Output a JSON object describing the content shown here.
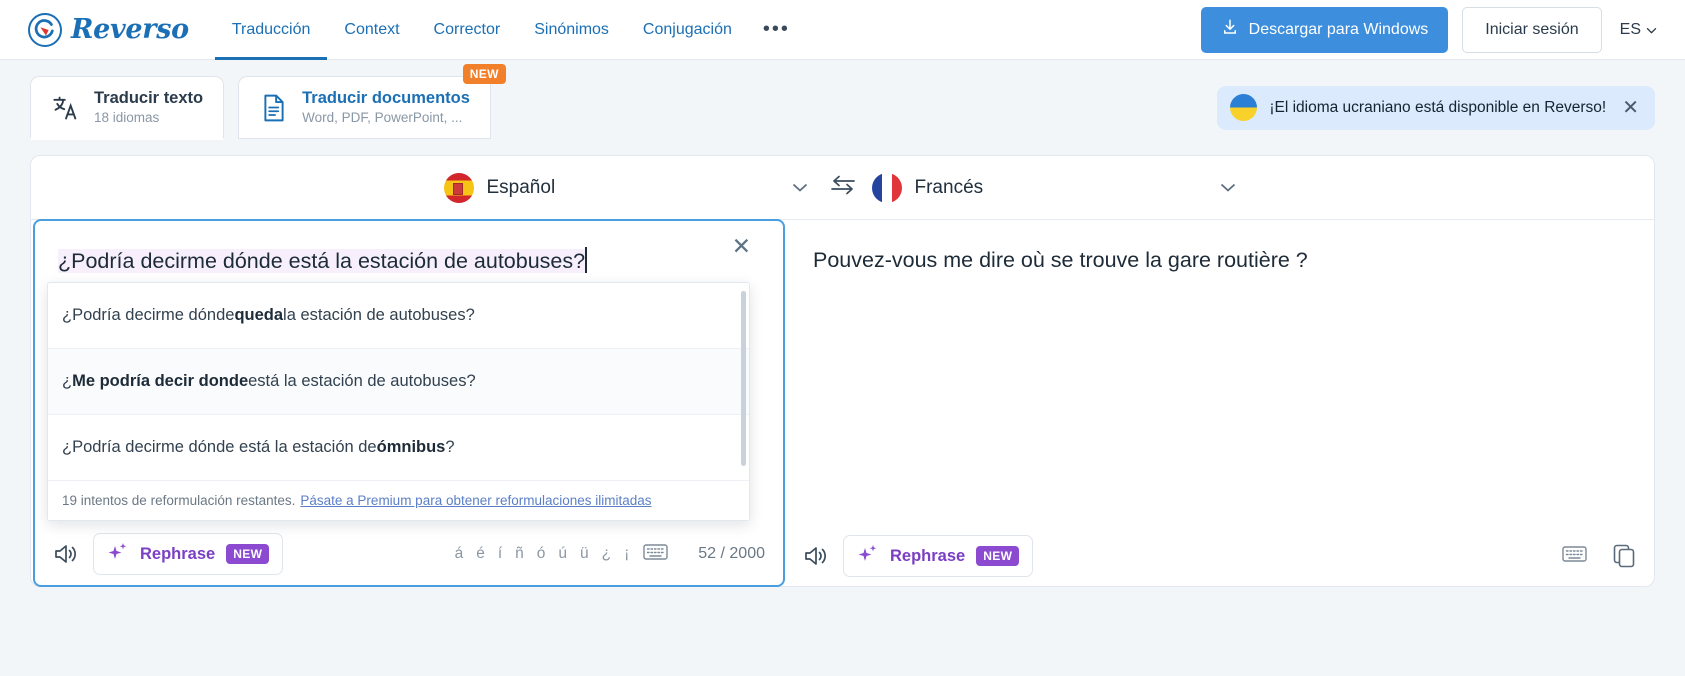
{
  "header": {
    "brand": "Reverso",
    "nav": [
      {
        "label": "Traducción",
        "active": true
      },
      {
        "label": "Context",
        "active": false
      },
      {
        "label": "Corrector",
        "active": false
      },
      {
        "label": "Sinónimos",
        "active": false
      },
      {
        "label": "Conjugación",
        "active": false
      }
    ],
    "more_label": "•••",
    "download_label": "Descargar para Windows",
    "login_label": "Iniciar sesión",
    "ui_language": "ES",
    "accent_color": "#1b6fb5",
    "download_bg": "#3d8fdd"
  },
  "tabs": [
    {
      "title": "Traducir texto",
      "subtitle": "18 idiomas",
      "icon": "translate-icon",
      "badge": null,
      "active": true
    },
    {
      "title": "Traducir documentos",
      "subtitle": "Word, PDF, PowerPoint, ...",
      "icon": "document-icon",
      "badge": "NEW",
      "active": false
    }
  ],
  "banner": {
    "icon": "ukraine-flag-icon",
    "text": "¡El idioma ucraniano está disponible en Reverso!",
    "close_label": "✕",
    "bg": "#dbeafc"
  },
  "language_bar": {
    "source": {
      "name": "Español",
      "flag": "spain-flag-icon"
    },
    "target": {
      "name": "Francés",
      "flag": "france-flag-icon"
    },
    "swap_label": "swap-languages-icon",
    "chevron": "⌄"
  },
  "source_pane": {
    "text": "¿Podría decirme dónde está la estación de autobuses?",
    "clear_label": "✕",
    "toolbar": {
      "speaker": "speaker-icon",
      "rephrase_label": "Rephrase",
      "rephrase_badge": "NEW",
      "accents": [
        "á",
        "é",
        "í",
        "ñ",
        "ó",
        "ú",
        "ü",
        "¿",
        "¡"
      ],
      "keyboard": "keyboard-icon",
      "counter": "52 / 2000"
    }
  },
  "target_pane": {
    "text": "Pouvez-vous me dire où se trouve la gare routière ?",
    "toolbar": {
      "speaker": "speaker-icon",
      "rephrase_label": "Rephrase",
      "rephrase_badge": "NEW",
      "keyboard": "keyboard-icon",
      "copy": "copy-icon"
    }
  },
  "suggestions": {
    "items": [
      {
        "pre": "¿Podría decirme dónde ",
        "bold": "queda",
        "post": " la estación de autobuses?",
        "hover": false
      },
      {
        "pre": "¿",
        "bold": "Me podría decir donde",
        "post": " está la estación de autobuses?",
        "hover": true
      },
      {
        "pre": "¿Podría decirme dónde está la estación de ",
        "bold": "ómnibus",
        "post": "?",
        "hover": false
      }
    ],
    "footer_text": "19 intentos de reformulación restantes.",
    "footer_link": "Pásate a Premium para obtener reformulaciones ilimitadas"
  }
}
